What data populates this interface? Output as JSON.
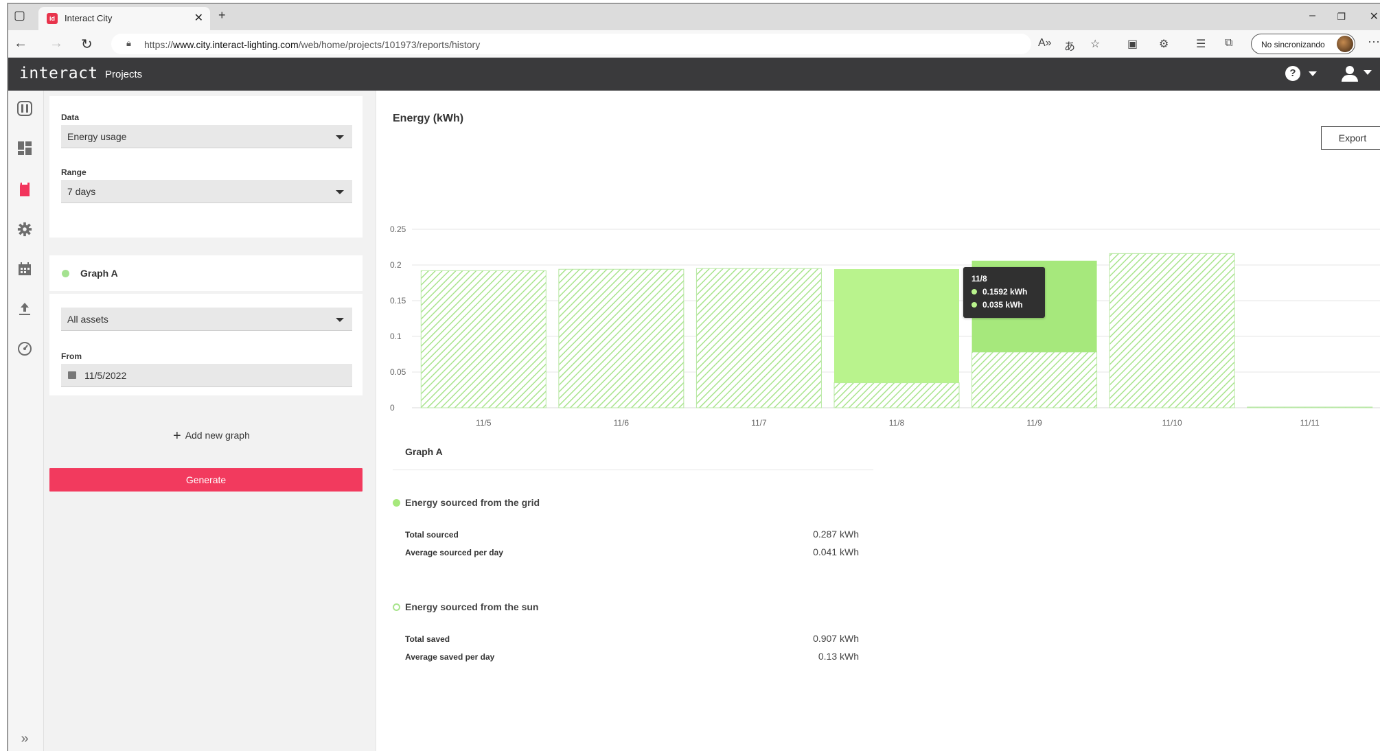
{
  "browser": {
    "tab_title": "Interact City",
    "tab_favicon_text": "id",
    "url_prefix": "https://",
    "url_host": "www.city.interact-lighting.com",
    "url_path": "/web/home/projects/101973/reports/history",
    "sync_label": "No sincronizando"
  },
  "app": {
    "logo": "interact",
    "nav_projects": "Projects",
    "help_glyph": "?"
  },
  "panel": {
    "data_label": "Data",
    "data_value": "Energy usage",
    "range_label": "Range",
    "range_value": "7 days",
    "graph_name": "Graph A",
    "assets_value": "All assets",
    "from_label": "From",
    "from_value": "11/5/2022",
    "add_graph_label": "Add new graph",
    "generate_label": "Generate"
  },
  "main": {
    "title": "Energy (kWh)",
    "export_label": "Export",
    "tooltip": {
      "date": "11/8",
      "line1": "0.1592 kWh",
      "line2": "0.035 kWh"
    },
    "summary": {
      "title": "Graph A",
      "grid_title": "Energy sourced from the grid",
      "total_sourced_label": "Total sourced",
      "total_sourced_value": "0.287 kWh",
      "avg_sourced_label": "Average sourced per day",
      "avg_sourced_value": "0.041 kWh",
      "sun_title": "Energy sourced from the sun",
      "total_saved_label": "Total saved",
      "total_saved_value": "0.907 kWh",
      "avg_saved_label": "Average saved per day",
      "avg_saved_value": "0.13 kWh"
    }
  },
  "colors": {
    "accent": "#f23a5e",
    "grid_energy": "#b9f38d",
    "grid_energy_active": "#a6e87c",
    "sun_energy_hatch": "#a8e48c",
    "appbar": "#3a3a3c"
  },
  "chart_data": {
    "type": "bar",
    "stacked": true,
    "categories": [
      "11/5",
      "11/6",
      "11/7",
      "11/8",
      "11/9",
      "11/10",
      "11/11"
    ],
    "ylim": [
      0,
      0.25
    ],
    "yticks": [
      0,
      0.05,
      0.1,
      0.15,
      0.2,
      0.25
    ],
    "grid": true,
    "series": [
      {
        "name": "Energy sourced from the sun",
        "pattern": "hatched",
        "values": [
          0.192,
          0.194,
          0.195,
          0.035,
          0.078,
          0.216,
          0.001
        ]
      },
      {
        "name": "Energy sourced from the grid",
        "pattern": "solid",
        "values": [
          0,
          0,
          0,
          0.1592,
          0.128,
          0,
          0
        ]
      }
    ]
  }
}
